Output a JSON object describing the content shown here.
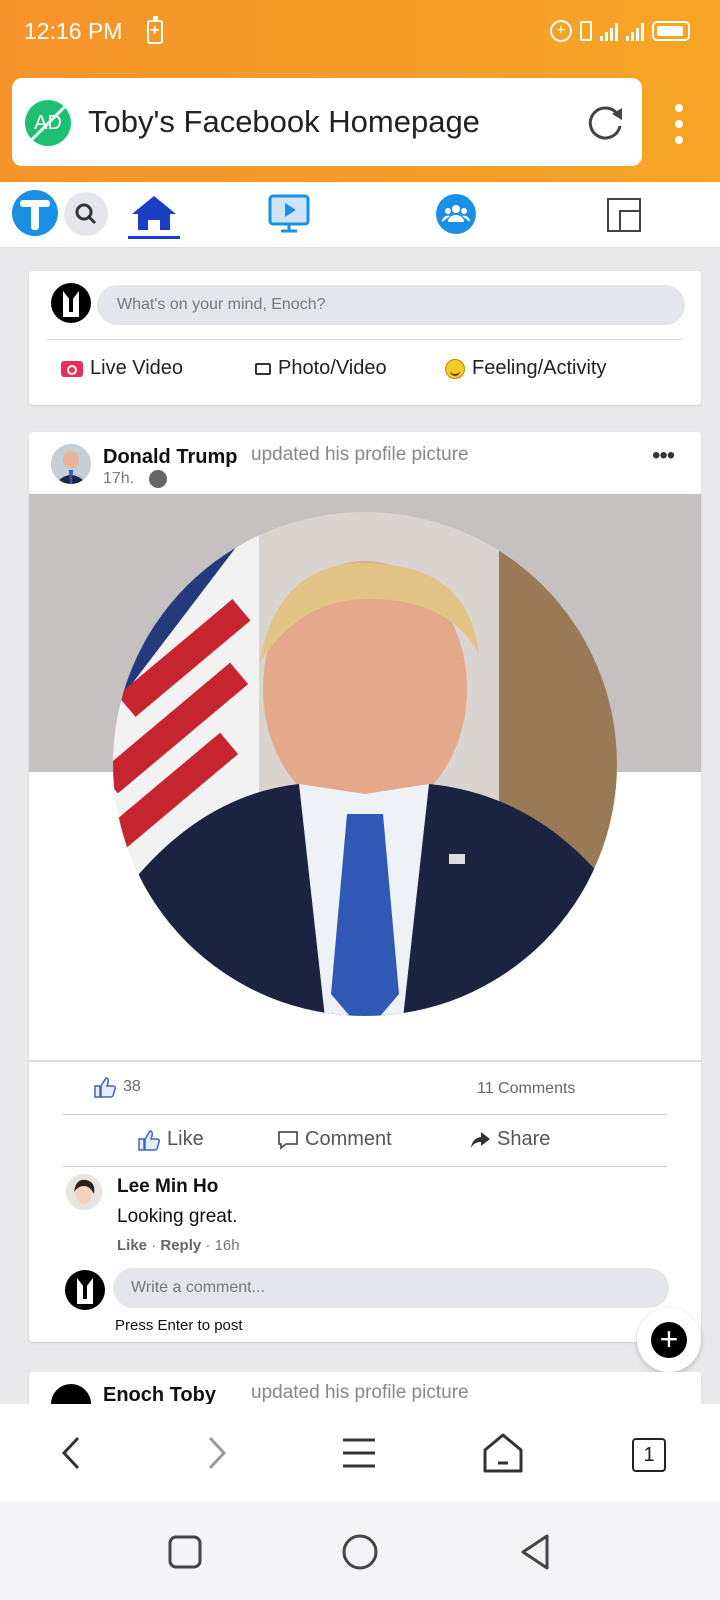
{
  "status_bar": {
    "time": "12:16 PM"
  },
  "browser": {
    "page_title": "Toby's Facebook Homepage",
    "ad_badge": "AD",
    "tab_count": "1"
  },
  "composer": {
    "placeholder": "What's on your mind, Enoch?",
    "actions": {
      "live": "Live Video",
      "photo": "Photo/Video",
      "feeling": "Feeling/Activity"
    }
  },
  "post": {
    "author": "Donald Trump",
    "action": "updated his profile picture",
    "time": "17h.",
    "likes": "38",
    "comments_count": "11 Comments",
    "buttons": {
      "like": "Like",
      "comment": "Comment",
      "share": "Share"
    },
    "comment": {
      "author": "Lee Min Ho",
      "text": "Looking great.",
      "like": "Like",
      "reply": "Reply",
      "time": "16h"
    },
    "write_placeholder": "Write a comment...",
    "press_enter": "Press Enter to post"
  },
  "next_post": {
    "author": "Enoch Toby",
    "action": "updated his profile picture"
  },
  "colors": {
    "header_orange": "#f5932a",
    "facebook_blue": "#1a8fe3",
    "home_blue": "#1a3ec4"
  }
}
